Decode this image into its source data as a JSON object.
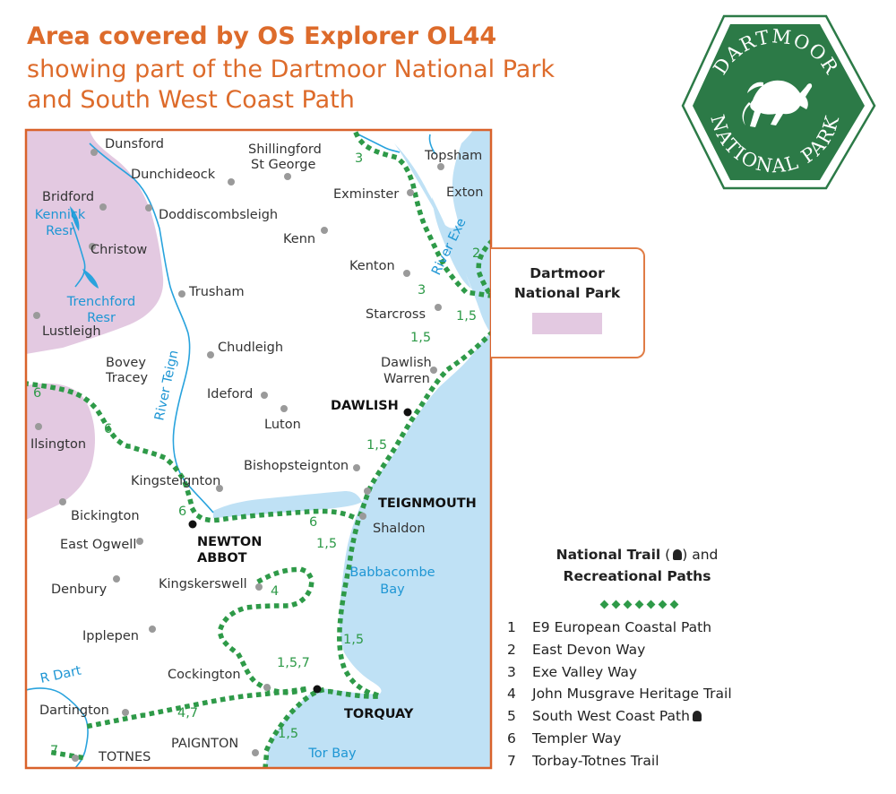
{
  "heading": {
    "line1": "Area covered by OS Explorer OL44",
    "line2": "showing part of the Dartmoor National Park",
    "line3": "and South West Coast Path"
  },
  "logo": {
    "top_text": "DARTMOOR",
    "bottom_text": "NATIONAL PARK"
  },
  "map": {
    "places": [
      {
        "name": "Dunsford"
      },
      {
        "name": "Shillingford"
      },
      {
        "name": "St George"
      },
      {
        "name": "Topsham"
      },
      {
        "name": "Dunchideock"
      },
      {
        "name": "Exminster"
      },
      {
        "name": "Exton"
      },
      {
        "name": "Bridford"
      },
      {
        "name": "Doddiscombsleigh"
      },
      {
        "name": "Kenn"
      },
      {
        "name": "Christow"
      },
      {
        "name": "Kenton"
      },
      {
        "name": "Trusham"
      },
      {
        "name": "Starcross"
      },
      {
        "name": "Lustleigh"
      },
      {
        "name": "Chudleigh"
      },
      {
        "name": "Bovey"
      },
      {
        "name": "Tracey"
      },
      {
        "name": "Dawlish"
      },
      {
        "name": "Warren"
      },
      {
        "name": "Ideford"
      },
      {
        "name": "Luton"
      },
      {
        "name": "Ilsington"
      },
      {
        "name": "Bishopsteignton"
      },
      {
        "name": "Kingsteignton"
      },
      {
        "name": "Bickington"
      },
      {
        "name": "Shaldon"
      },
      {
        "name": "East Ogwell"
      },
      {
        "name": "Kingskerswell"
      },
      {
        "name": "Denbury"
      },
      {
        "name": "Ipplepen"
      },
      {
        "name": "Cockington"
      },
      {
        "name": "Dartington"
      },
      {
        "name": "TOTNES"
      },
      {
        "name": "PAIGNTON"
      }
    ],
    "towns": [
      {
        "name": "DAWLISH"
      },
      {
        "name": "TEIGNMOUTH"
      },
      {
        "name": "NEWTON"
      },
      {
        "name": "ABBOT"
      },
      {
        "name": "TORQUAY"
      }
    ],
    "water": [
      {
        "name": "Kennick"
      },
      {
        "name": "Resr"
      },
      {
        "name": "Trenchford"
      },
      {
        "name": "Resr"
      },
      {
        "name": "River Teign"
      },
      {
        "name": "River Exe"
      },
      {
        "name": "Babbacombe"
      },
      {
        "name": "Bay"
      },
      {
        "name": "R Dart"
      },
      {
        "name": "Tor Bay"
      }
    ],
    "route_labels": [
      "3",
      "3",
      "2",
      "1,5",
      "1,5",
      "6",
      "6",
      "1,5",
      "6",
      "6",
      "1,5",
      "4",
      "1,5",
      "1,5,7",
      "4,7",
      "1,5",
      "7"
    ]
  },
  "park_key": {
    "title_line1": "Dartmoor",
    "title_line2": "National Park",
    "swatch_color": "#e3c9e1"
  },
  "legend": {
    "title_bold1": "National Trail",
    "title_mid": " (",
    "title_end": ") and",
    "title_bold2": "Recreational Paths",
    "items": [
      {
        "num": "1",
        "label": "E9 European Coastal Path"
      },
      {
        "num": "2",
        "label": "East Devon Way"
      },
      {
        "num": "3",
        "label": "Exe Valley Way"
      },
      {
        "num": "4",
        "label": "John Musgrave Heritage Trail"
      },
      {
        "num": "5",
        "label": "South West Coast Path"
      },
      {
        "num": "6",
        "label": "Templer Way"
      },
      {
        "num": "7",
        "label": "Torbay-Totnes Trail"
      }
    ]
  },
  "colors": {
    "heading": "#dd6b2b",
    "frame": "#d9622b",
    "park": "#e3c9e1",
    "sea": "#bfe1f5",
    "river": "#29a3dd",
    "route": "#2e9a48",
    "logo_green": "#2c7a47"
  }
}
